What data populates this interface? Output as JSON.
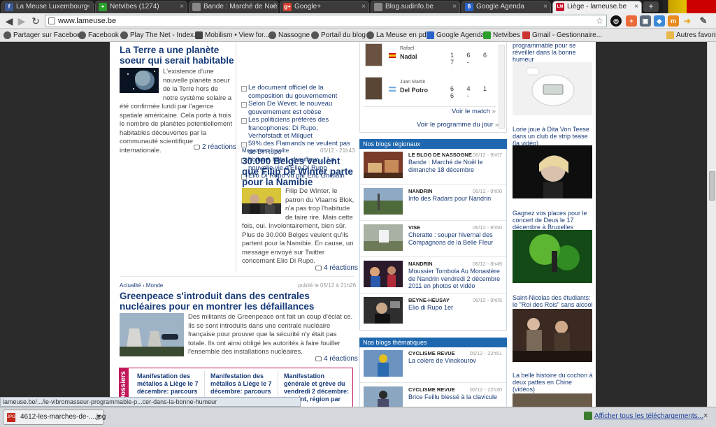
{
  "browser": {
    "tabs": [
      {
        "label": "La Meuse Luxembourg",
        "icon": "f",
        "color": "#3b5998"
      },
      {
        "label": "Netvibes (1274)",
        "icon": "+",
        "color": "#2aa02a"
      },
      {
        "label": "Bande : Marché de Noël le",
        "icon": "",
        "color": "#888888"
      },
      {
        "label": "Google+",
        "icon": "g+",
        "color": "#d23f31"
      },
      {
        "label": "Blog.sudinfo.be",
        "icon": "",
        "color": "#888888"
      },
      {
        "label": "Google Agenda",
        "icon": "8",
        "color": "#2a62c9"
      },
      {
        "label": "Liège - lameuse.be",
        "icon": "LM",
        "color": "#c8102e"
      }
    ],
    "new_tab": "+",
    "url": "www.lameuse.be",
    "bookmarks": [
      "Partager sur Facebook",
      "Facebook",
      "Play The Net - Index...",
      "Mobilism • View for...",
      "Nassogne",
      "Portail du blog",
      "La Meuse en pdf",
      "Google Agenda",
      "Netvibes",
      "Gmail - Gestionnaire...",
      "Autres favoris"
    ],
    "status_url": "lameuse.be/.../le-vibromasseur-programmable-p...cer-dans-la-bonne-humeur",
    "download": {
      "filename": "4612-les-marches-de-....jpg",
      "show_all": "Afficher tous les téléchargements...",
      "close": "×"
    }
  },
  "articles": {
    "planet": {
      "title": "La Terre a une planète soeur qui serait habitable",
      "body": "L'existence d'une nouvelle planète soeur de la Terre hors de notre système solaire a été confirmée lundi par l'agence spatiale américaine. Cela porte à trois le nombre de planètes potentiellement habitables découvertes par la communauté scientifique internationale.",
      "reactions": "2 réactions"
    },
    "bullets": [
      "Le document officiel de la composition du gouvernement",
      "Selon De Wever, le nouveau gouvernement est obèse",
      "Les politiciens préférés des francophones: Di Rupo, Verhofstadt et Milquet",
      "59% des Flamands ne veulent pas de Di Rupo",
      "Voiture, hôtel, chauffeur,... La nouvelle vie d'Elio Di Rupo",
      "Elio Di Rupo vu par Eric Ghislain"
    ],
    "namibie": {
      "kicker": "Magazine › Insolite",
      "date": "05/12 - 21h43",
      "title": "30.000 Belges veulent que Filip De Winter parte pour la Namibie",
      "body": "Filip De Winter, le patron du Vlaams Blok, n'a pas trop l'habitude de faire rire. Mais cette fois, oui. Involontairement, bien sûr. Plus de 30.000 Belges veulent qu'ils partent pour la Namibie. En cause, un message envoyé sur Twitter concernant Elio Di Rupo.",
      "reactions": "4 réactions"
    },
    "greenpeace": {
      "kicker": "Actualité › Monde",
      "date": "publié le 05/12 à 21h26",
      "title": "Greenpeace s'introduit dans des centrales nucléaires pour en montrer les défaillances",
      "body": "Des militants de Greenpeace ont fait un coup d'éclat ce. Ils se sont introduits dans une centrale nucléaire française pour prouver que la sécurité n'y était pas totale. Ils ont ainsi obligé les autorités à faire fouiller l'ensemble des installations nucléaires.",
      "reactions": "4 réactions"
    },
    "dossiers": {
      "label": "Dossiers",
      "items": [
        "Manifestation des métallos à Liège le 7 décembre: parcours",
        "Manifestation des métallos à Liège le 7 décembre: parcours",
        "Manifestation générale et grève du vendredi 2 décembre: le point, région par"
      ]
    }
  },
  "tennis": {
    "players": [
      {
        "first": "Rafael",
        "last": "Nadal",
        "score": "1 6 6 7 -"
      },
      {
        "first": "Juan Martin",
        "last": "Del Potro",
        "score": "6 4 1 6 -"
      }
    ],
    "see_match": "Voir le match",
    "see_schedule": "Voir le programme du jour"
  },
  "regional_blogs": {
    "heading": "Nos blogs régionaux",
    "items": [
      {
        "source": "LE BLOG DE NASSOGNE",
        "date": "06/12 - 9h07",
        "title": "Bande : Marché de Noël le dimanche 18 décembre",
        "color": "#7a3b2a"
      },
      {
        "source": "NANDRIN",
        "date": "06/12 - 9h00",
        "title": "Info des Radars pour Nandrin",
        "color": "#4f6a3a"
      },
      {
        "source": "VISE",
        "date": "06/12 - 8h50",
        "title": "Cheratte : souper hivernal des Compagnons de la Belle Fleur",
        "color": "#8a8f86"
      },
      {
        "source": "NANDRIN",
        "date": "06/12 - 8h49",
        "title": "Moussier Tombola Au Monastère de Nandrin vendredi 2 décembre 2011 en photos et vidéo",
        "color": "#5a2c3a"
      },
      {
        "source": "BEYNE-HEUSAY",
        "date": "06/12 - 9h05",
        "title": "Elio di Rupo 1er",
        "color": "#3a3a3a"
      }
    ]
  },
  "thematic_blogs": {
    "heading": "Nos blogs thématiques",
    "items": [
      {
        "source": "CYCLISME REVUE",
        "date": "05/12 - 22h51",
        "title": "La colère de Vinokourov",
        "color": "#4d7fb5"
      },
      {
        "source": "CYCLISME REVUE",
        "date": "05/12 - 22h30",
        "title": "Brice Feillu blessé à la clavicule",
        "color": "#6a8fb0"
      }
    ]
  },
  "right_column": {
    "top": "programmable pour se réveiller dans la bonne humeur",
    "items": [
      "Lorie joue à Dita Von Teese dans un club de strip tease (la vidéo)",
      "Gagnez vos places pour le concert de Deus le 17 décembre à Bruxelles",
      "Saint-Nicolas des étudiants: le \"Roi des Rois\" sans alcool",
      "La belle histoire du cochon à deux pattes en Chine (vidéos)"
    ]
  }
}
